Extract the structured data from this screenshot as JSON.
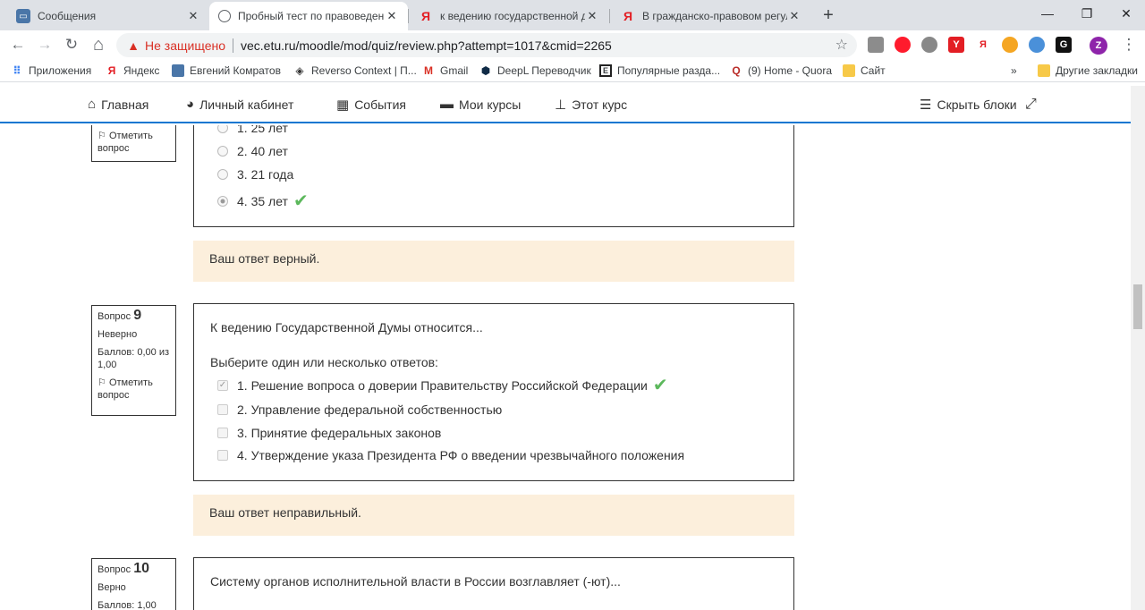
{
  "browser": {
    "tabs": [
      {
        "title": "Сообщения",
        "icon": "chat-icon",
        "color": "#4a76a8"
      },
      {
        "title": "Пробный тест по правоведени",
        "icon": "globe-icon",
        "active": true
      },
      {
        "title": "к ведению государственной ду",
        "icon": "yandex-icon",
        "color": "#e31e24"
      },
      {
        "title": "В гражданско-правовом регули",
        "icon": "yandex-icon",
        "color": "#e31e24"
      }
    ],
    "new_tab": "+",
    "window": {
      "minimize": "—",
      "maximize": "❐",
      "close": "✕"
    },
    "toolbar": {
      "back": "←",
      "forward": "→",
      "reload": "↻",
      "home": "⌂"
    },
    "address": {
      "security": "Не защищено",
      "url": "vec.etu.ru/moodle/mod/quiz/review.php?attempt=1017&cmid=2265",
      "star": "☆"
    },
    "extensions": [
      "Y",
      "Я",
      "G",
      "Z"
    ],
    "bookmarks": [
      {
        "label": "Приложения",
        "icon": "apps-grid-icon"
      },
      {
        "label": "Яндекс",
        "icon": "yandex-icon"
      },
      {
        "label": "Евгений Комратов",
        "icon": "chat-icon"
      },
      {
        "label": "Reverso Context | П...",
        "icon": "reverso-icon"
      },
      {
        "label": "Gmail",
        "icon": "gmail-icon"
      },
      {
        "label": "DeepL Переводчик",
        "icon": "deepl-icon"
      },
      {
        "label": "Популярные разда...",
        "icon": "bookmark-e-icon"
      },
      {
        "label": "(9) Home - Quora",
        "icon": "quora-icon"
      },
      {
        "label": "Сайт",
        "icon": "folder-icon"
      }
    ],
    "bookmarks_more": "»",
    "other_bookmarks": "Другие закладки"
  },
  "moodle_nav": {
    "home": "Главная",
    "cabinet": "Личный кабинет",
    "events": "События",
    "my_courses": "Мои курсы",
    "this_course": "Этот курс",
    "hide_blocks": "Скрыть блоки"
  },
  "q8": {
    "flag": "Отметить вопрос",
    "answers": [
      "1. 25 лет",
      "2. 40 лет",
      "3. 21 года",
      "4. 35 лет"
    ],
    "feedback": "Ваш ответ верный."
  },
  "q9": {
    "label": "Вопрос",
    "number": "9",
    "state": "Неверно",
    "grade": "Баллов: 0,00 из 1,00",
    "flag": "Отметить вопрос",
    "text": "К ведению Государственной Думы относится...",
    "prompt": "Выберите один или несколько ответов:",
    "answers": [
      "1. Решение вопроса о доверии Правительству Российской Федерации",
      "2. Управление федеральной собственностью",
      "3. Принятие федеральных законов",
      "4. Утверждение указа Президента РФ о введении чрезвычайного положения"
    ],
    "feedback": "Ваш ответ неправильный."
  },
  "q10": {
    "label": "Вопрос",
    "number": "10",
    "state": "Верно",
    "grade": "Баллов: 1,00",
    "text": "Систему органов исполнительной власти в России возглавляет (-ют)..."
  },
  "colors": {
    "accent": "#1177d1",
    "feedback_bg": "#fcefdc",
    "correct": "#5cb85c",
    "warning": "#d93025"
  }
}
